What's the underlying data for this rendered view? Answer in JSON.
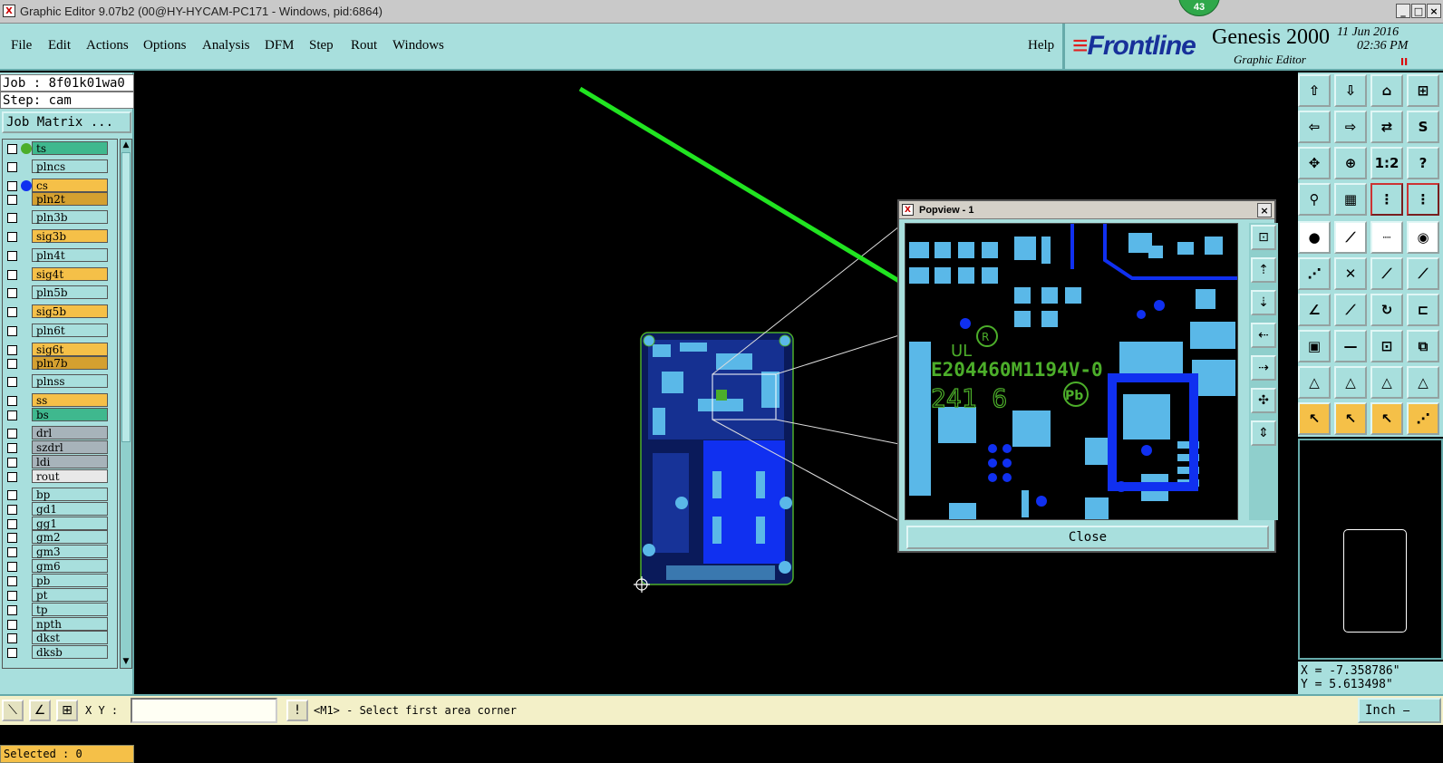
{
  "window": {
    "title": "Graphic Editor 9.07b2 (00@HY-HYCAM-PC171 - Windows, pid:6864)",
    "badge_count": "43"
  },
  "menu": {
    "items": [
      "File",
      "Edit",
      "Actions",
      "Options",
      "Analysis",
      "DFM",
      "Step",
      "Rout",
      "Windows"
    ],
    "help": "Help"
  },
  "brand": {
    "logo": "Frontline",
    "product": "Genesis 2000",
    "subtitle": "Graphic Editor",
    "date": "11 Jun 2016",
    "time": "02:36 PM",
    "pause": "II"
  },
  "left_panel": {
    "job": "Job : 8f01k01wa0",
    "step": "Step: cam",
    "job_matrix": "Job Matrix ...",
    "layers": [
      {
        "name": "ts",
        "color": "#3fb88e",
        "dot": "#4cae2a"
      },
      {
        "name": "plncs",
        "color": "#a8dfdd",
        "dot": ""
      },
      {
        "name": "cs",
        "color": "#f5c048",
        "dot": "#1030f0"
      },
      {
        "name": "pln2t",
        "color": "#d4a030",
        "dot": ""
      },
      {
        "name": "pln3b",
        "color": "#a8dfdd",
        "dot": ""
      },
      {
        "name": "sig3b",
        "color": "#f5c048",
        "dot": ""
      },
      {
        "name": "pln4t",
        "color": "#a8dfdd",
        "dot": ""
      },
      {
        "name": "sig4t",
        "color": "#f5c048",
        "dot": ""
      },
      {
        "name": "pln5b",
        "color": "#a8dfdd",
        "dot": ""
      },
      {
        "name": "sig5b",
        "color": "#f5c048",
        "dot": ""
      },
      {
        "name": "pln6t",
        "color": "#a8dfdd",
        "dot": ""
      },
      {
        "name": "sig6t",
        "color": "#f5c048",
        "dot": ""
      },
      {
        "name": "pln7b",
        "color": "#d4a030",
        "dot": ""
      },
      {
        "name": "plnss",
        "color": "#a8dfdd",
        "dot": ""
      },
      {
        "name": "ss",
        "color": "#f5c048",
        "dot": ""
      },
      {
        "name": "bs",
        "color": "#3fb88e",
        "dot": ""
      },
      {
        "name": "drl",
        "color": "#a7b3ba",
        "dot": ""
      },
      {
        "name": "szdrl",
        "color": "#a7b3ba",
        "dot": ""
      },
      {
        "name": "ldi",
        "color": "#a7b3ba",
        "dot": ""
      },
      {
        "name": "rout",
        "color": "#e8e8e8",
        "dot": ""
      },
      {
        "name": "bp",
        "color": "#a8dfdd",
        "dot": ""
      },
      {
        "name": "gd1",
        "color": "#a8dfdd",
        "dot": ""
      },
      {
        "name": "gg1",
        "color": "#a8dfdd",
        "dot": ""
      },
      {
        "name": "gm2",
        "color": "#a8dfdd",
        "dot": ""
      },
      {
        "name": "gm3",
        "color": "#a8dfdd",
        "dot": ""
      },
      {
        "name": "gm6",
        "color": "#a8dfdd",
        "dot": ""
      },
      {
        "name": "pb",
        "color": "#a8dfdd",
        "dot": ""
      },
      {
        "name": "pt",
        "color": "#a8dfdd",
        "dot": ""
      },
      {
        "name": "tp",
        "color": "#a8dfdd",
        "dot": ""
      },
      {
        "name": "npth",
        "color": "#a8dfdd",
        "dot": ""
      },
      {
        "name": "dkst",
        "color": "#a8dfdd",
        "dot": ""
      },
      {
        "name": "dksb",
        "color": "#a8dfdd",
        "dot": ""
      }
    ],
    "selected": "Selected : 0"
  },
  "popview": {
    "title": "Popview - 1",
    "ul_code": "E204460M1194V-0",
    "date_code": "241 6",
    "pb_mark": "Pb",
    "close": "Close"
  },
  "bottom": {
    "xy_label": "X Y :",
    "xy_value": "",
    "message": "<M1> - Select first area corner",
    "unit": "Inch"
  },
  "coords": {
    "x": "X = -7.358786\"",
    "y": "Y = 5.613498\""
  },
  "colors": {
    "panel": "#a8dfdd",
    "copper_dark": "#1030f0",
    "copper_light": "#5ab8e8",
    "silkscreen": "#4cae2a",
    "arrow": "#21e421"
  },
  "icons": [
    "gear-icon",
    "arrow-icon",
    "zoom-icon"
  ]
}
